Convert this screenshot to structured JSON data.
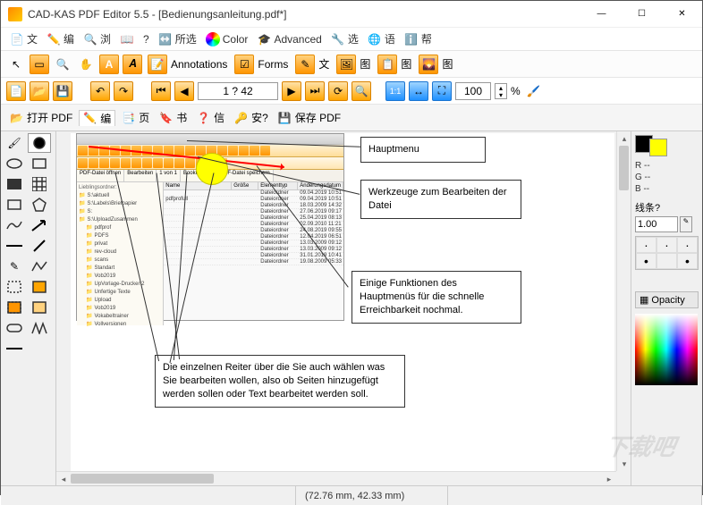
{
  "window": {
    "title": "CAD-KAS PDF Editor 5.5 - [Bedienungsanleitung.pdf*]"
  },
  "menu": {
    "file": "文",
    "edit": "编",
    "view": "浏",
    "book": "",
    "help": "?",
    "all": "所选",
    "color": "Color",
    "advanced": "Advanced",
    "options": "选",
    "lang": "语",
    "helpq": "帮"
  },
  "toolbar1": {
    "annotations": "Annotations",
    "forms": "Forms",
    "wen": "文",
    "tu": "图",
    "tu2": "图",
    "tu3": "图"
  },
  "nav": {
    "page": "1 ? 42",
    "zoom": "100",
    "pct": "%"
  },
  "toolbar3": {
    "open": "打开 PDF",
    "bian": "编",
    "ye": "页",
    "shu": "书",
    "xin": "信",
    "an": "安?",
    "save": "保存 PDF"
  },
  "right": {
    "r": "R --",
    "g": "G --",
    "b": "B --",
    "linesq": "线条?",
    "lineval": "1.00",
    "opacity": "Opacity"
  },
  "callouts": {
    "c1": "Hauptmenu",
    "c2": "Werkzeuge zum Bearbeiten der Datei",
    "c3": "Einige Funktionen des Hauptmenüs für die schnelle Erreichbarkeit nochmal.",
    "c4": "Die einzelnen Reiter über die Sie auch wählen was Sie bearbeiten wollen, also ob Seiten hinzugefügt werden sollen oder Text bearbeitet werden soll."
  },
  "doc": {
    "tabs": [
      "PDF-Datei öffnen",
      "Bearbeiten",
      "1 von 1",
      "Bookmark",
      "",
      "PDF-Datei speichern"
    ],
    "lh": {
      "name": "Name",
      "size": "Größe",
      "type": "Elementtyp",
      "date": "Änderungsdatum"
    },
    "tree": [
      "S:\\aktuell",
      "S:\\Labels\\Briefpapier",
      "S:",
      "S:\\UploadZusammen"
    ],
    "folders": [
      "pdfprof",
      "PDFS",
      "privat",
      "rev-cloud",
      "scans",
      "Standart",
      "Vob2019",
      "UpVorlage-Drucker 2",
      "Unfertige Texte",
      "Upload",
      "Vob2019",
      "Vokabeltrainer",
      "Vollversionen"
    ],
    "rows": [
      {
        "n": "",
        "t": "Dateiordner",
        "d": "09.04.2019 10:51"
      },
      {
        "n": "pdfprofull",
        "t": "Dateiordner",
        "d": "09.04.2019 10:51"
      },
      {
        "n": "",
        "t": "Dateiordner",
        "d": "18.03.2009 14:32"
      },
      {
        "n": "",
        "t": "Dateiordner",
        "d": "27.06.2019 09:17"
      },
      {
        "n": "",
        "t": "Dateiordner",
        "d": "25.04.2019 08:13"
      },
      {
        "n": "",
        "t": "Dateiordner",
        "d": "02.09.2010 11:21"
      },
      {
        "n": "",
        "t": "Dateiordner",
        "d": "24.08.2019 09:55"
      },
      {
        "n": "",
        "t": "Dateiordner",
        "d": "12.04.2019 06:51"
      },
      {
        "n": "",
        "t": "Dateiordner",
        "d": "13.03.2009 09:12"
      },
      {
        "n": "",
        "t": "Dateiordner",
        "d": "13.03.2009 09:12"
      },
      {
        "n": "",
        "t": "Dateiordner",
        "d": "31.01.2019 10:41"
      },
      {
        "n": "",
        "t": "Dateiordner",
        "d": "19.08.2009 05:33"
      }
    ]
  },
  "status": {
    "coords": "(72.76 mm, 42.33 mm)"
  },
  "watermark": "下载吧"
}
